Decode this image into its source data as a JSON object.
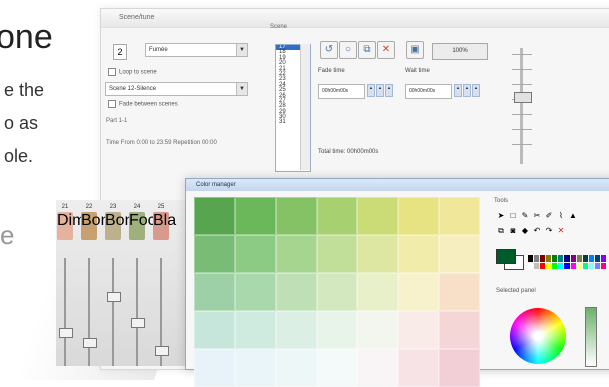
{
  "hero": {
    "title": "one",
    "lines": [
      "e the",
      "o as",
      "ole."
    ],
    "tail": "e"
  },
  "main": {
    "title": "Scene/tune",
    "number": "2",
    "select_top": "Fumée",
    "loop_label": "Loop to scene",
    "select_mid": "Scene 12-Silence",
    "fade_between": "Fade between scenes",
    "part_label": "Part 1-1",
    "time_line": "Time From 0:00  to  23:59 Repetition  00:00",
    "scene_label": "Scene",
    "list_items": [
      "17",
      "18",
      "19",
      "20",
      "21",
      "22",
      "23",
      "24",
      "25",
      "26",
      "27",
      "28",
      "29",
      "30",
      "31"
    ],
    "fade_time_label": "Fade time",
    "fade_time_value": "00h00m00s",
    "wait_time_label": "Wait time",
    "wait_time_value": "00h00m00s",
    "total_time": "Total time: 00h00m00s",
    "percent": "100%"
  },
  "mixer": {
    "channels": [
      {
        "num": "21",
        "label": "Dim"
      },
      {
        "num": "22",
        "label": "Bon"
      },
      {
        "num": "23",
        "label": "Bon"
      },
      {
        "num": "24",
        "label": "Foc"
      },
      {
        "num": "25",
        "label": "Bla"
      }
    ]
  },
  "dialog": {
    "title": "Color manager",
    "tools_label": "Tools",
    "selected_label": "Selected panel"
  },
  "colors": {
    "grid": [
      "#57a64f",
      "#6ab85a",
      "#85c266",
      "#a7d070",
      "#cbdc77",
      "#e7e282",
      "#f0e79a",
      "#79bc76",
      "#8ccb84",
      "#a6d58f",
      "#c2df9a",
      "#dde7a2",
      "#f1ecaa",
      "#f7eec0",
      "#9ed0a7",
      "#aad8ad",
      "#bfe0b6",
      "#d4e8bf",
      "#e7f0c9",
      "#f7f2cb",
      "#f8e0c8",
      "#c7e6db",
      "#cfeadf",
      "#dcefe4",
      "#e8f4e9",
      "#f2f6ee",
      "#f9ece8",
      "#f5d6d6",
      "#e7f3f8",
      "#e9f5f8",
      "#eef7f8",
      "#f4f9f9",
      "#f9f4f6",
      "#f7e2e6",
      "#f2cfd7"
    ],
    "swatches": [
      "#000000",
      "#808080",
      "#800000",
      "#808000",
      "#008000",
      "#008080",
      "#000080",
      "#800080",
      "#808040",
      "#004040",
      "#0080ff",
      "#004080",
      "#8000ff",
      "#ffffff",
      "#c0c0c0",
      "#ff0000",
      "#ffff00",
      "#00ff00",
      "#00ffff",
      "#0000ff",
      "#ff00ff",
      "#ffff80",
      "#00ff80",
      "#80ffff",
      "#8080ff",
      "#ff0080"
    ],
    "channel_badges": [
      "#e5b39d",
      "#c8a06f",
      "#bdb08c",
      "#9fb07d",
      "#d89a8c"
    ]
  }
}
